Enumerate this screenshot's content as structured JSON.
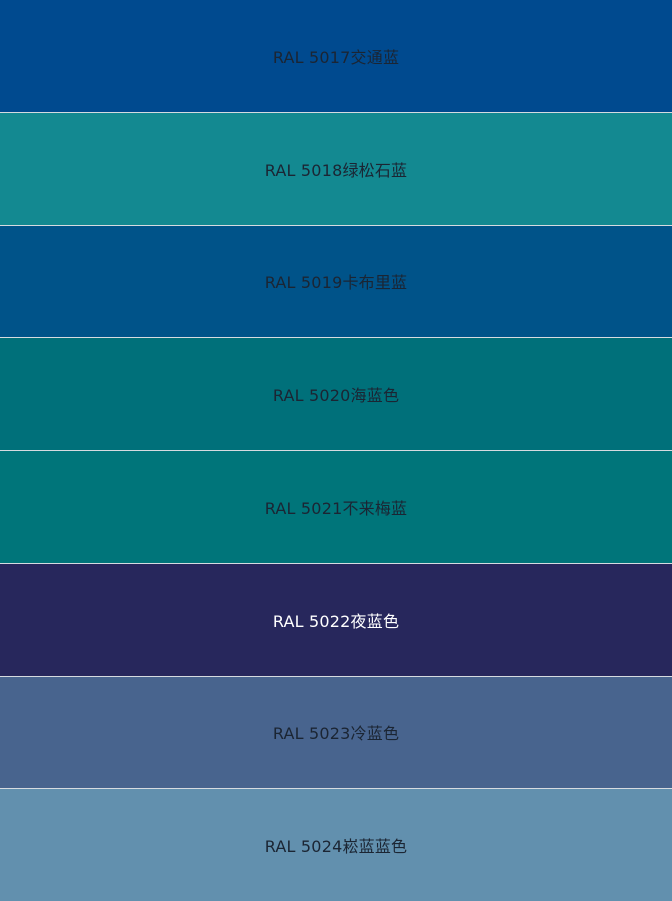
{
  "swatches": [
    {
      "label": "RAL 5017交通蓝",
      "color": "#004a8f"
    },
    {
      "label": "RAL 5018绿松石蓝",
      "color": "#138991"
    },
    {
      "label": "RAL 5019卡布里蓝",
      "color": "#005389"
    },
    {
      "label": "RAL 5020海蓝色",
      "color": "#00707a"
    },
    {
      "label": "RAL 5021不来梅蓝",
      "color": "#00757a"
    },
    {
      "label": "RAL 5022夜蓝色",
      "color": "#27275c",
      "text_color": "#ffffff"
    },
    {
      "label": "RAL 5023冷蓝色",
      "color": "#48648e"
    },
    {
      "label": "RAL 5024崧蓝蓝色",
      "color": "#6290ae"
    }
  ]
}
